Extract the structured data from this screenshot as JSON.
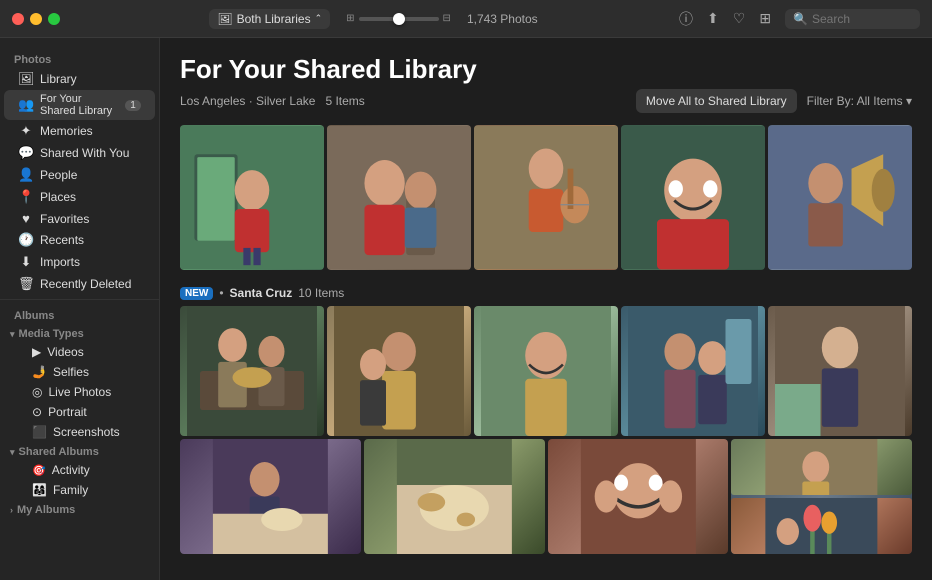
{
  "titlebar": {
    "library_picker": "Both Libraries",
    "photo_count": "1,743 Photos",
    "search_placeholder": "Search"
  },
  "sidebar": {
    "photos_section": "Photos",
    "items": [
      {
        "id": "library",
        "label": "Library",
        "icon": "🖼"
      },
      {
        "id": "for-your-shared-library",
        "label": "For Your Shared Library",
        "icon": "👥",
        "badge": "1",
        "active": true
      },
      {
        "id": "memories",
        "label": "Memories",
        "icon": "✦"
      },
      {
        "id": "shared-with-you",
        "label": "Shared With You",
        "icon": "💬"
      },
      {
        "id": "people",
        "label": "People",
        "icon": "👤"
      },
      {
        "id": "places",
        "label": "Places",
        "icon": "📍"
      },
      {
        "id": "favorites",
        "label": "Favorites",
        "icon": "♥"
      },
      {
        "id": "recents",
        "label": "Recents",
        "icon": "🕐"
      },
      {
        "id": "imports",
        "label": "Imports",
        "icon": "⬇"
      },
      {
        "id": "recently-deleted",
        "label": "Recently Deleted",
        "icon": "🗑"
      }
    ],
    "albums_section": "Albums",
    "album_groups": [
      {
        "id": "media-types",
        "label": "Media Types",
        "items": [
          {
            "id": "videos",
            "label": "Videos",
            "icon": "▶"
          },
          {
            "id": "selfies",
            "label": "Selfies",
            "icon": "🤳"
          },
          {
            "id": "live-photos",
            "label": "Live Photos",
            "icon": "◎"
          },
          {
            "id": "portrait",
            "label": "Portrait",
            "icon": "⊙"
          },
          {
            "id": "screenshots",
            "label": "Screenshots",
            "icon": "⬛"
          }
        ]
      },
      {
        "id": "shared-albums",
        "label": "Shared Albums",
        "items": [
          {
            "id": "activity",
            "label": "Activity",
            "icon": "🎯"
          },
          {
            "id": "family",
            "label": "Family",
            "icon": "👨‍👩‍👧"
          }
        ]
      },
      {
        "id": "my-albums",
        "label": "My Albums",
        "items": []
      }
    ]
  },
  "content": {
    "title": "For Your Shared Library",
    "sections": [
      {
        "id": "los-angeles",
        "location": "Los Angeles · Silver Lake",
        "item_count": "5 Items",
        "is_new": false
      },
      {
        "id": "santa-cruz",
        "location": "Santa Cruz",
        "item_count": "10 Items",
        "is_new": true,
        "new_label": "NEW"
      }
    ],
    "move_button": "Move All to Shared Library",
    "filter_label": "Filter By: All Items ▾"
  }
}
